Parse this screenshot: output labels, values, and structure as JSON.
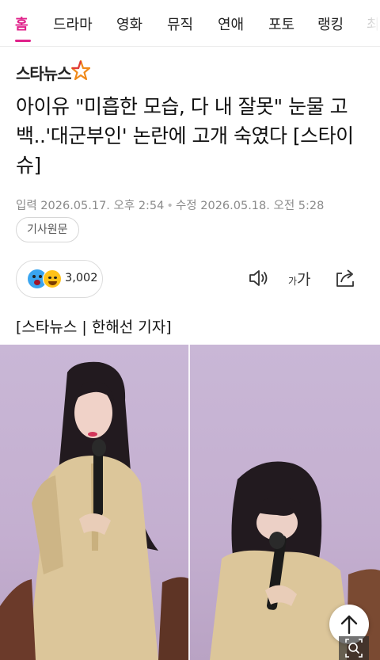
{
  "nav": {
    "tabs": [
      {
        "label": "홈",
        "active": true
      },
      {
        "label": "드라마"
      },
      {
        "label": "영화"
      },
      {
        "label": "뮤직"
      },
      {
        "label": "연애"
      },
      {
        "label": "포토"
      },
      {
        "label": "랭킹"
      },
      {
        "label": "최"
      }
    ]
  },
  "brand": {
    "logo_text": "스타뉴스",
    "accent_color": "#e0218a",
    "star_colors": [
      "#e03a3a",
      "#f08a1a"
    ]
  },
  "article": {
    "headline": "아이유 \"미흡한 모습, 다 내 잘못\" 눈물 고백..'대군부인' 논란에 고개 숙였다 [스타이슈]",
    "published": "입력 2026.05.17. 오후 2:54",
    "updated": "수정 2026.05.18. 오전 5:28",
    "tag": "기사원문",
    "reaction_count": "3,002",
    "font_small": "가",
    "font_big": "가",
    "byline": "[스타뉴스 | 한해선 기자]"
  },
  "icons": {
    "audio": "speaker-icon",
    "share": "share-icon",
    "scroll_top": "arrow-up-icon",
    "zoom": "magnify-icon"
  }
}
